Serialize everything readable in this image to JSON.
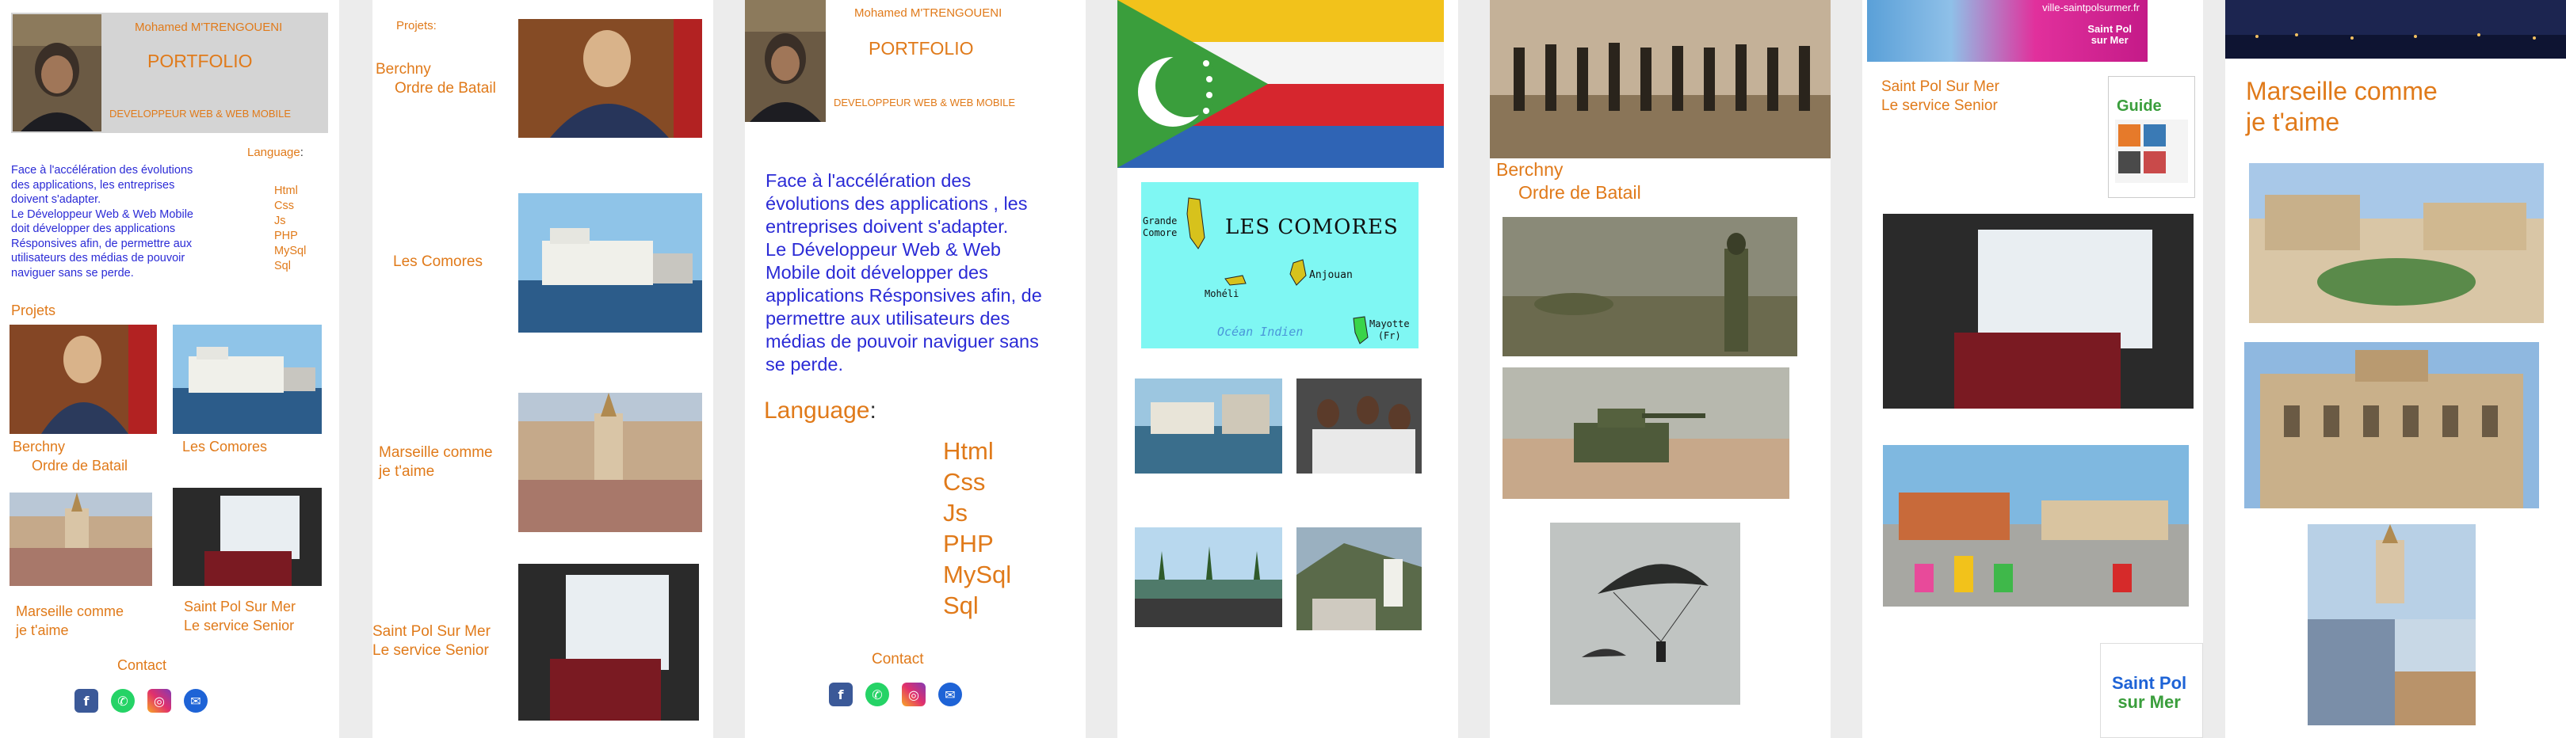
{
  "author": "Mohamed M'TRENGOUENI",
  "portfolio_title": "PORTFOLIO",
  "role": "DEVELOPPEUR WEB & WEB MOBILE",
  "intro": [
    "Face à l'accélération des évolutions",
    "des applications, les entreprises",
    "doivent s'adapter.",
    "Le Développeur Web & Web Mobile",
    "doit développer des applications",
    "Résponsives afin, de permettre aux",
    "utilisateurs des médias de pouvoir",
    "naviguer sans se perde."
  ],
  "intro_large": [
    "Face à l'accélération des",
    "évolutions des applications , les",
    "entreprises doivent s'adapter.",
    "Le Développeur Web & Web",
    "Mobile doit développer des",
    "applications Résponsives afin, de",
    "permettre aux utilisateurs des",
    "médias de pouvoir naviguer sans",
    "se perde."
  ],
  "language_label": "Language",
  "language_colon": ":",
  "languages": [
    "Html",
    "Css",
    "Js",
    "PHP",
    "MySql",
    "Sql"
  ],
  "projects_heading": "Projets",
  "projects_heading_colon": "Projets:",
  "projects": {
    "berchny": [
      "Berchny",
      "Ordre de Batail"
    ],
    "comores": "Les Comores",
    "marseille": [
      "Marseille comme",
      "je t'aime"
    ],
    "saintpol": [
      "Saint Pol Sur Mer",
      "Le service Senior"
    ]
  },
  "contact_label": "Contact",
  "contact_icons": [
    "facebook-icon",
    "whatsapp-icon",
    "instagram-icon",
    "email-icon"
  ],
  "map": {
    "title": "LES COMORES",
    "grande_comore": [
      "Grande",
      "Comore"
    ],
    "moheli": "Mohéli",
    "anjouan": "Anjouan",
    "mayotte": [
      "Mayotte",
      "(Fr)"
    ],
    "ocean": "Océan Indien"
  },
  "saintpol_site": "ville-saintpolsurmer.fr",
  "saintpol_logo": [
    "Saint Pol",
    "sur Mer"
  ],
  "guide_title": "Guide",
  "colors": {
    "accent_orange": "#e07a1a",
    "intro_blue": "#2b2bd6",
    "header_grey": "#d4d4d4",
    "map_cyan": "#7ff7f3",
    "map_green": "#39d44a",
    "map_yellow": "#d7c21c"
  }
}
